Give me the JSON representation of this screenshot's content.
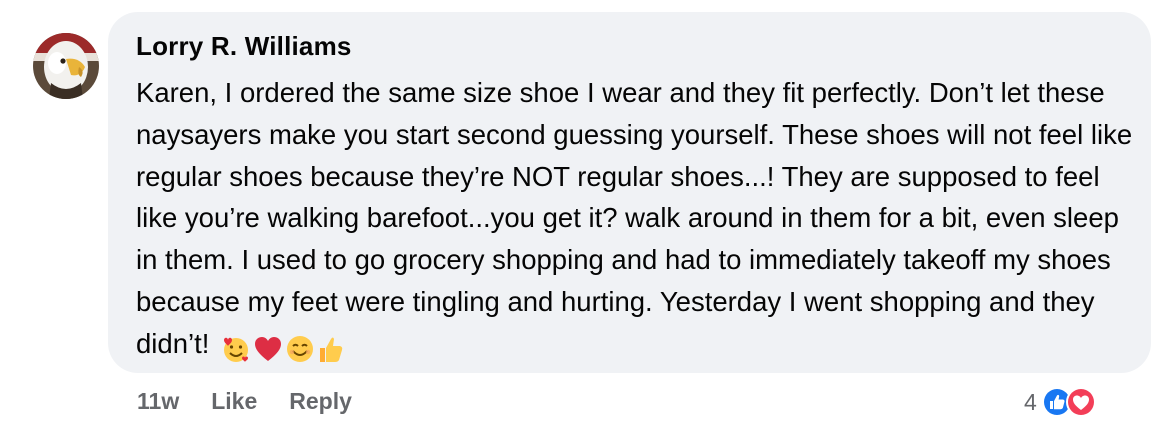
{
  "comment": {
    "author": "Lorry R. Williams",
    "text": "Karen, I ordered the same size shoe I wear and they fit perfectly. Don’t let these naysayers make you start second guessing yourself. These shoes will not feel like regular shoes because they’re NOT regular shoes...! They are supposed to feel like you’re walking barefoot...you get it? walk around in them for a bit, even sleep in them. I used to go grocery shopping and had to immediately takeoff my shoes because my feet were tingling and hurting. Yesterday I went shopping and they didn’t!",
    "emojis": [
      "smiling-face-with-hearts",
      "red-heart",
      "smiling-face",
      "thumbs-up"
    ]
  },
  "actions": {
    "timestamp": "11w",
    "like_label": "Like",
    "reply_label": "Reply"
  },
  "reactions": {
    "count": "4",
    "types": [
      "like",
      "love"
    ],
    "like_color": "#1877f2",
    "love_color": "#f33e58"
  },
  "colors": {
    "bubble_bg": "#f0f2f5",
    "text": "#050505",
    "muted": "#65676b"
  }
}
